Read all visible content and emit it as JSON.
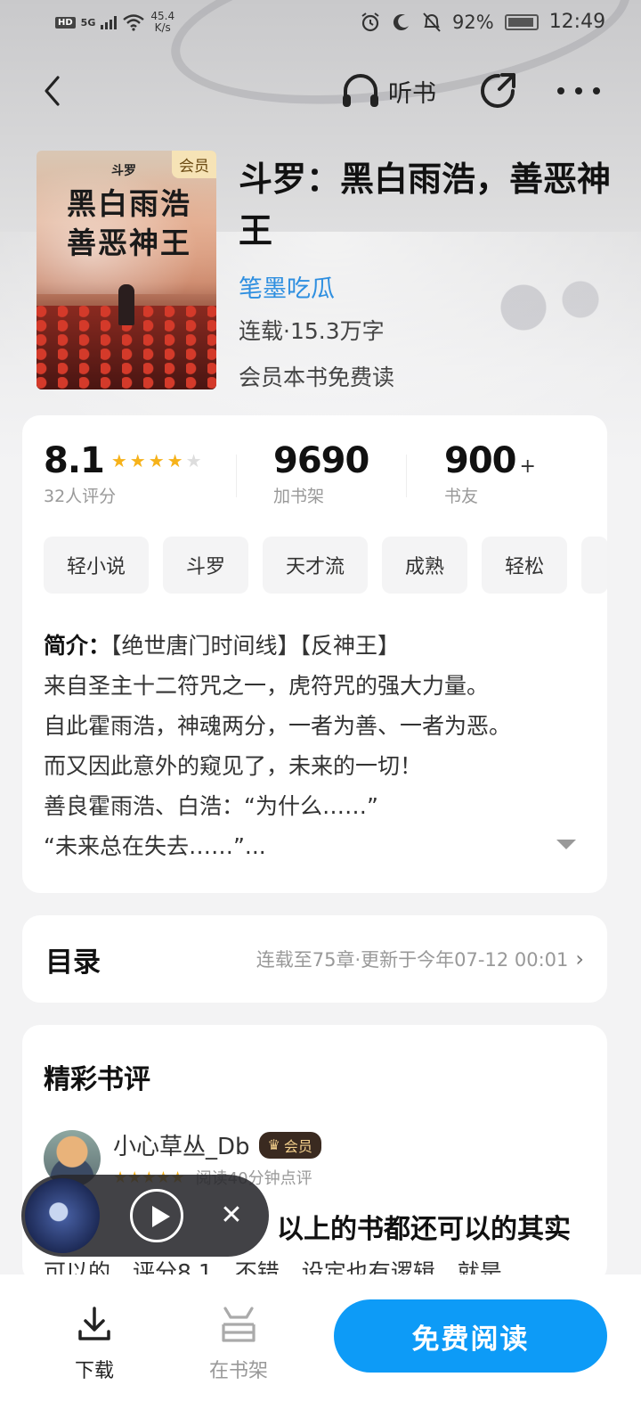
{
  "status_bar": {
    "network_badge": "HD",
    "signal_label": "5G",
    "net_speed_value": "45.4",
    "net_speed_unit": "K/s",
    "battery": "92%",
    "time": "12:49"
  },
  "nav": {
    "listen_label": "听书"
  },
  "book": {
    "cover": {
      "series": "斗罗",
      "badge": "会员",
      "title_line1": "黑白雨浩",
      "title_line2": "善恶神王"
    },
    "title": "斗罗：黑白雨浩，善恶神王",
    "author": "笔墨吃瓜",
    "meta": "连载·15.3万字",
    "free_note": "会员本书免费读"
  },
  "stats": {
    "rating": "8.1",
    "rating_stars": 4,
    "rating_count": "32人评分",
    "shelf_count": "9690",
    "shelf_label": "加书架",
    "friends_count": "900",
    "friends_plus": "+",
    "friends_label": "书友"
  },
  "tags": [
    "轻小说",
    "斗罗",
    "天才流",
    "成熟",
    "轻松"
  ],
  "intro": {
    "label": "简介：",
    "line1": "【绝世唐门时间线】【反神王】",
    "line2": "来自圣主十二符咒之一，虎符咒的强大力量。",
    "line3": "自此霍雨浩，神魂两分，一者为善、一者为恶。",
    "line4": "而又因此意外的窥见了，未来的一切！",
    "line5": "善良霍雨浩、白浩：“为什么……”",
    "line6": "“未来总在失去……”..."
  },
  "toc": {
    "title": "目录",
    "info": "连载至75章·更新于今年07-12 00:01"
  },
  "reviews": {
    "title": "精彩书评",
    "user": "小心草丛_Db",
    "vip": "会员",
    "stars": "★★★★★",
    "time_note": "阅读40分钟点评",
    "line1": "以上的书都还可以的其实",
    "line2": "可以的，评分8.1，不错，设定也有逻辑，就是"
  },
  "bottom_bar": {
    "download_label": "下载",
    "shelf_label": "在书架",
    "read_label": "免费阅读"
  },
  "colors": {
    "accent": "#0d9bf7",
    "author_link": "#2f8fe0",
    "star": "#f6b21a"
  }
}
